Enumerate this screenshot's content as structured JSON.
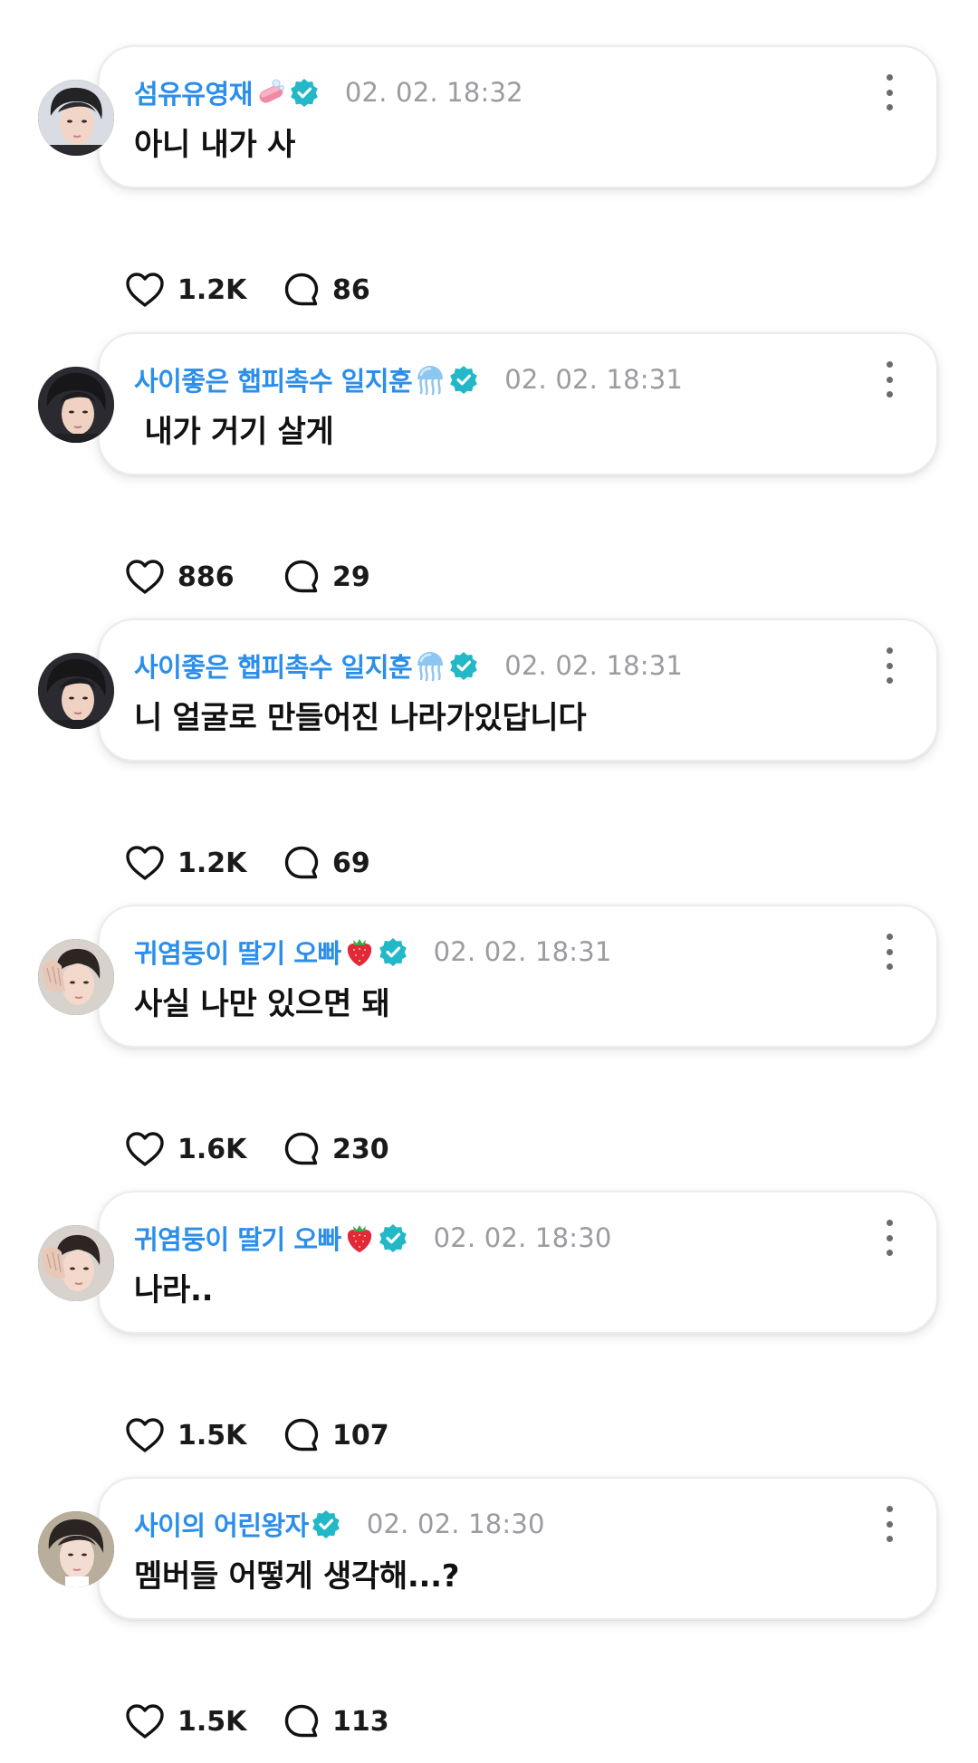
{
  "colors": {
    "username": "#2b8eea",
    "verified_badge": "#22b8c8",
    "timestamp": "#9b9ba0",
    "message": "#111111",
    "card_border": "#ececee"
  },
  "icons": {
    "like": "heart-outline-icon",
    "reply": "speech-bubble-outline-icon",
    "more": "vertical-ellipsis-icon",
    "verified": "verified-badge-icon"
  },
  "posts": [
    {
      "username": "섬유유영재",
      "name_emoji": "soap",
      "timestamp": "02. 02. 18:32",
      "message": "아니 내가 사",
      "likes": "1.2K",
      "replies": "86"
    },
    {
      "username": "사이좋은 햅피촉수 일지훈",
      "name_emoji": "jellyfish",
      "timestamp": "02. 02. 18:31",
      "message": " 내가 거기 살게",
      "likes": "886",
      "replies": "29"
    },
    {
      "username": "사이좋은 햅피촉수 일지훈",
      "name_emoji": "jellyfish",
      "timestamp": "02. 02. 18:31",
      "message": "니 얼굴로 만들어진 나라가있답니다",
      "likes": "1.2K",
      "replies": "69"
    },
    {
      "username": "귀염둥이 딸기 오빠",
      "name_emoji": "strawberry",
      "timestamp": "02. 02. 18:31",
      "message": "사실 나만 있으면 돼",
      "likes": "1.6K",
      "replies": "230"
    },
    {
      "username": "귀염둥이 딸기 오빠",
      "name_emoji": "strawberry",
      "timestamp": "02. 02. 18:30",
      "message": "나라..",
      "likes": "1.5K",
      "replies": "107"
    },
    {
      "username": "사이의 어린왕자",
      "name_emoji": "",
      "timestamp": "02. 02. 18:30",
      "message": "멤버들 어떻게 생각해...?",
      "likes": "1.5K",
      "replies": "113"
    }
  ]
}
